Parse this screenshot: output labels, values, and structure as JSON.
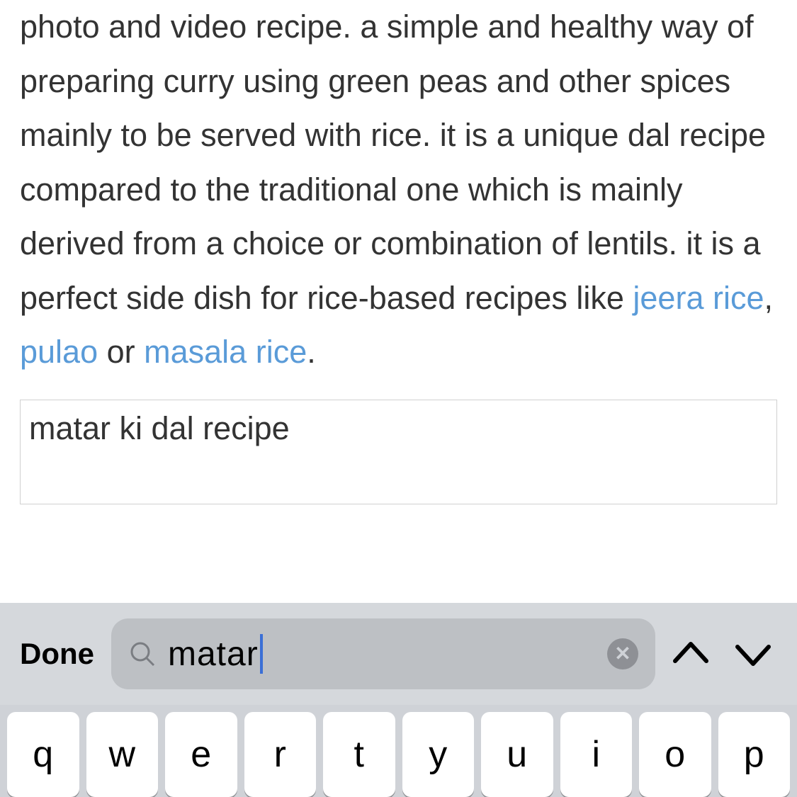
{
  "article": {
    "paragraph_part1": "photo and video recipe. a simple and healthy way of preparing curry using green peas and other spices mainly to be served with rice. it is a unique dal recipe compared to the traditional one which is mainly derived from a choice or combination of lentils. it is a perfect side dish for rice-based recipes like ",
    "link1": "jeera rice",
    "sep1": ", ",
    "link2": "pulao",
    "sep2": " or ",
    "link3": "masala rice",
    "tail": "."
  },
  "box_text": "matar ki dal recipe",
  "findbar": {
    "done_label": "Done",
    "query": "matar",
    "clear_glyph": "✕"
  },
  "keyboard": {
    "row1": [
      "q",
      "w",
      "e",
      "r",
      "t",
      "y",
      "u",
      "i",
      "o",
      "p"
    ]
  }
}
